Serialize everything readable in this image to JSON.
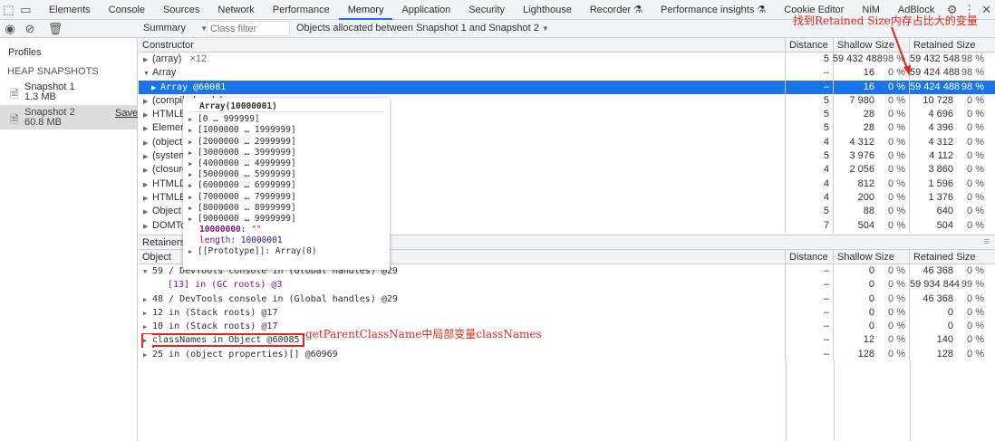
{
  "tabs": [
    "Elements",
    "Console",
    "Sources",
    "Network",
    "Performance",
    "Memory",
    "Application",
    "Security",
    "Lighthouse",
    "Recorder ⚗",
    "Performance insights ⚗",
    "Cookie Editor",
    "NiM",
    "AdBlock"
  ],
  "active_tab": "Memory",
  "toolbar": {
    "view": "Summary",
    "filter_placeholder": "Class filter",
    "range": "Objects allocated between Snapshot 1 and Snapshot 2"
  },
  "sidebar": {
    "profiles": "Profiles",
    "section": "HEAP SNAPSHOTS",
    "snapshots": [
      {
        "name": "Snapshot 1",
        "size": "1.3 MB"
      },
      {
        "name": "Snapshot 2",
        "size": "60.8 MB",
        "save": "Save"
      }
    ]
  },
  "columns": {
    "constructor": "Constructor",
    "object": "Object",
    "distance": "Distance",
    "shallow": "Shallow Size",
    "retained": "Retained Size"
  },
  "constructors": [
    {
      "name": "(array)",
      "count": "×12",
      "dist": "5",
      "sh": "59 432 488",
      "shp": "98 %",
      "re": "59 432 548",
      "rep": "98 %",
      "tri": "▶"
    },
    {
      "name": "Array",
      "dist": "–",
      "sh": "16",
      "shp": "0 %",
      "re": "59 424 488",
      "rep": "98 %",
      "tri": "▼"
    },
    {
      "name": "Array @60081",
      "dist": "–",
      "sh": "16",
      "shp": "0 %",
      "re": "59 424 488",
      "rep": "98 %",
      "tri": "▶",
      "sel": true,
      "indent": true
    },
    {
      "name": "(compiled code)",
      "dist": "5",
      "sh": "7 980",
      "shp": "0 %",
      "re": "10 728",
      "rep": "0 %",
      "tri": "▶"
    },
    {
      "name": "HTMLElement",
      "dist": "5",
      "sh": "28",
      "shp": "0 %",
      "re": "4 696",
      "rep": "0 %",
      "tri": "▶"
    },
    {
      "name": "Element",
      "dist": "5",
      "sh": "28",
      "shp": "0 %",
      "re": "4 396",
      "rep": "0 %",
      "tri": "▶"
    },
    {
      "name": "(object shape)",
      "dist": "4",
      "sh": "4 312",
      "shp": "0 %",
      "re": "4 312",
      "rep": "0 %",
      "tri": "▶"
    },
    {
      "name": "(system)",
      "dist": "5",
      "sh": "3 976",
      "shp": "0 %",
      "re": "4 112",
      "rep": "0 %",
      "tri": "▶"
    },
    {
      "name": "(closure)",
      "dist": "4",
      "sh": "2 056",
      "shp": "0 %",
      "re": "3 860",
      "rep": "0 %",
      "tri": "▶"
    },
    {
      "name": "HTMLDivElement",
      "dist": "4",
      "sh": "812",
      "shp": "0 %",
      "re": "1 596",
      "rep": "0 %",
      "tri": "▶"
    },
    {
      "name": "HTMLBodyElement",
      "dist": "4",
      "sh": "200",
      "shp": "0 %",
      "re": "1 376",
      "rep": "0 %",
      "tri": "▶"
    },
    {
      "name": "Object",
      "dist": "5",
      "sh": "88",
      "shp": "0 %",
      "re": "640",
      "rep": "0 %",
      "tri": "▶"
    },
    {
      "name": "DOMTokenList",
      "dist": "7",
      "sh": "504",
      "shp": "0 %",
      "re": "504",
      "rep": "0 %",
      "tri": "▶"
    }
  ],
  "retainers_label": "Retainers",
  "retainers": [
    {
      "name": "59 / DevTools console in (Global handles) @29",
      "dist": "–",
      "sh": "0",
      "shp": "0 %",
      "re": "46 368",
      "rep": "0 %",
      "tri": "▼"
    },
    {
      "name": "[13] in (GC roots) @3",
      "dist": "–",
      "sh": "0",
      "shp": "0 %",
      "re": "59 934 844",
      "rep": "99 %",
      "tri": "",
      "indent": true
    },
    {
      "name": "48 / DevTools console in (Global handles) @29",
      "dist": "–",
      "sh": "0",
      "shp": "0 %",
      "re": "46 368",
      "rep": "0 %",
      "tri": "▶"
    },
    {
      "name": "12 in (Stack roots) @17",
      "dist": "–",
      "sh": "0",
      "shp": "0 %",
      "re": "0",
      "rep": "0 %",
      "tri": "▶"
    },
    {
      "name": "10 in (Stack roots) @17",
      "dist": "–",
      "sh": "0",
      "shp": "0 %",
      "re": "0",
      "rep": "0 %",
      "tri": "▶"
    },
    {
      "name": "classNames in Object @60085",
      "dist": "–",
      "sh": "12",
      "shp": "0 %",
      "re": "140",
      "rep": "0 %",
      "tri": "▶",
      "boxed": true
    },
    {
      "name": "25 in (object properties)[] @60969",
      "dist": "–",
      "sh": "128",
      "shp": "0 %",
      "re": "128",
      "rep": "0 %",
      "tri": "▶"
    }
  ],
  "popup": {
    "title": "Array(10000001)",
    "ranges": [
      "[0 … 999999]",
      "[1000000 … 1999999]",
      "[2000000 … 2999999]",
      "[3000000 … 3999999]",
      "[4000000 … 4999999]",
      "[5000000 … 5999999]",
      "[6000000 … 6999999]",
      "[7000000 … 7999999]",
      "[8000000 … 8999999]",
      "[9000000 … 9999999]"
    ],
    "last_key": "10000000",
    "last_val": "\"\"",
    "length_key": "length",
    "length_val": "10000001",
    "proto": "[[Prototype]]: Array(0)"
  },
  "annotations": {
    "top": "找到Retained Size内存占比大的变量",
    "bottom": "getParentClassName中局部变量classNames",
    "color": "#e0261f"
  }
}
